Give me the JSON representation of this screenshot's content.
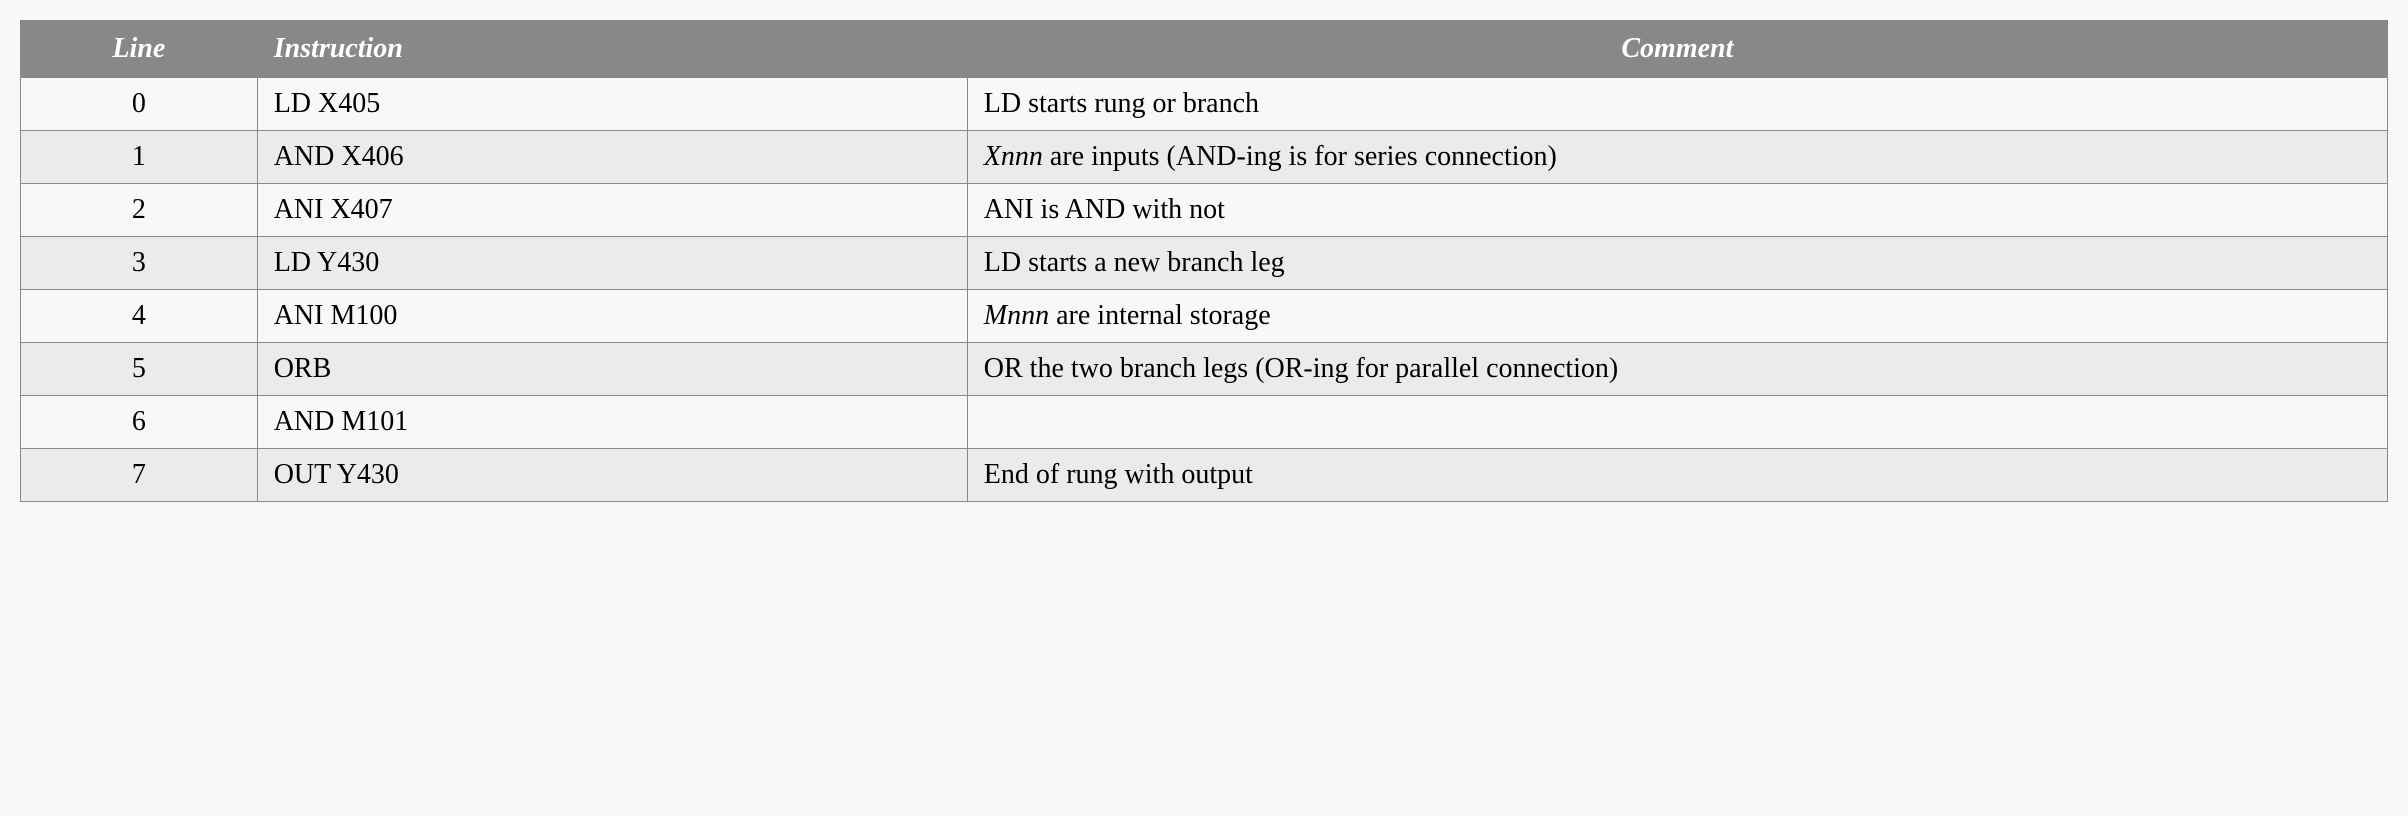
{
  "table": {
    "headers": {
      "line": "Line",
      "instruction": "Instruction",
      "comment": "Comment"
    },
    "rows": [
      {
        "line": "0",
        "instruction": "LD X405",
        "comment_prefix": "",
        "comment_italic": "",
        "comment_suffix": "LD starts rung or branch"
      },
      {
        "line": "1",
        "instruction": "AND X406",
        "comment_prefix": "",
        "comment_italic": "Xnnn",
        "comment_suffix": " are inputs (AND-ing is for series connection)"
      },
      {
        "line": "2",
        "instruction": "ANI X407",
        "comment_prefix": "",
        "comment_italic": "",
        "comment_suffix": "ANI is AND with not"
      },
      {
        "line": "3",
        "instruction": "LD Y430",
        "comment_prefix": "",
        "comment_italic": "",
        "comment_suffix": "LD starts a new branch leg"
      },
      {
        "line": "4",
        "instruction": "ANI M100",
        "comment_prefix": "",
        "comment_italic": "Mnnn",
        "comment_suffix": " are internal storage"
      },
      {
        "line": "5",
        "instruction": "ORB",
        "comment_prefix": "",
        "comment_italic": "",
        "comment_suffix": "OR the two branch legs (OR-ing for parallel connection)"
      },
      {
        "line": "6",
        "instruction": "AND M101",
        "comment_prefix": "",
        "comment_italic": "",
        "comment_suffix": ""
      },
      {
        "line": "7",
        "instruction": "OUT Y430",
        "comment_prefix": "",
        "comment_italic": "",
        "comment_suffix": "End of rung with output"
      }
    ]
  }
}
